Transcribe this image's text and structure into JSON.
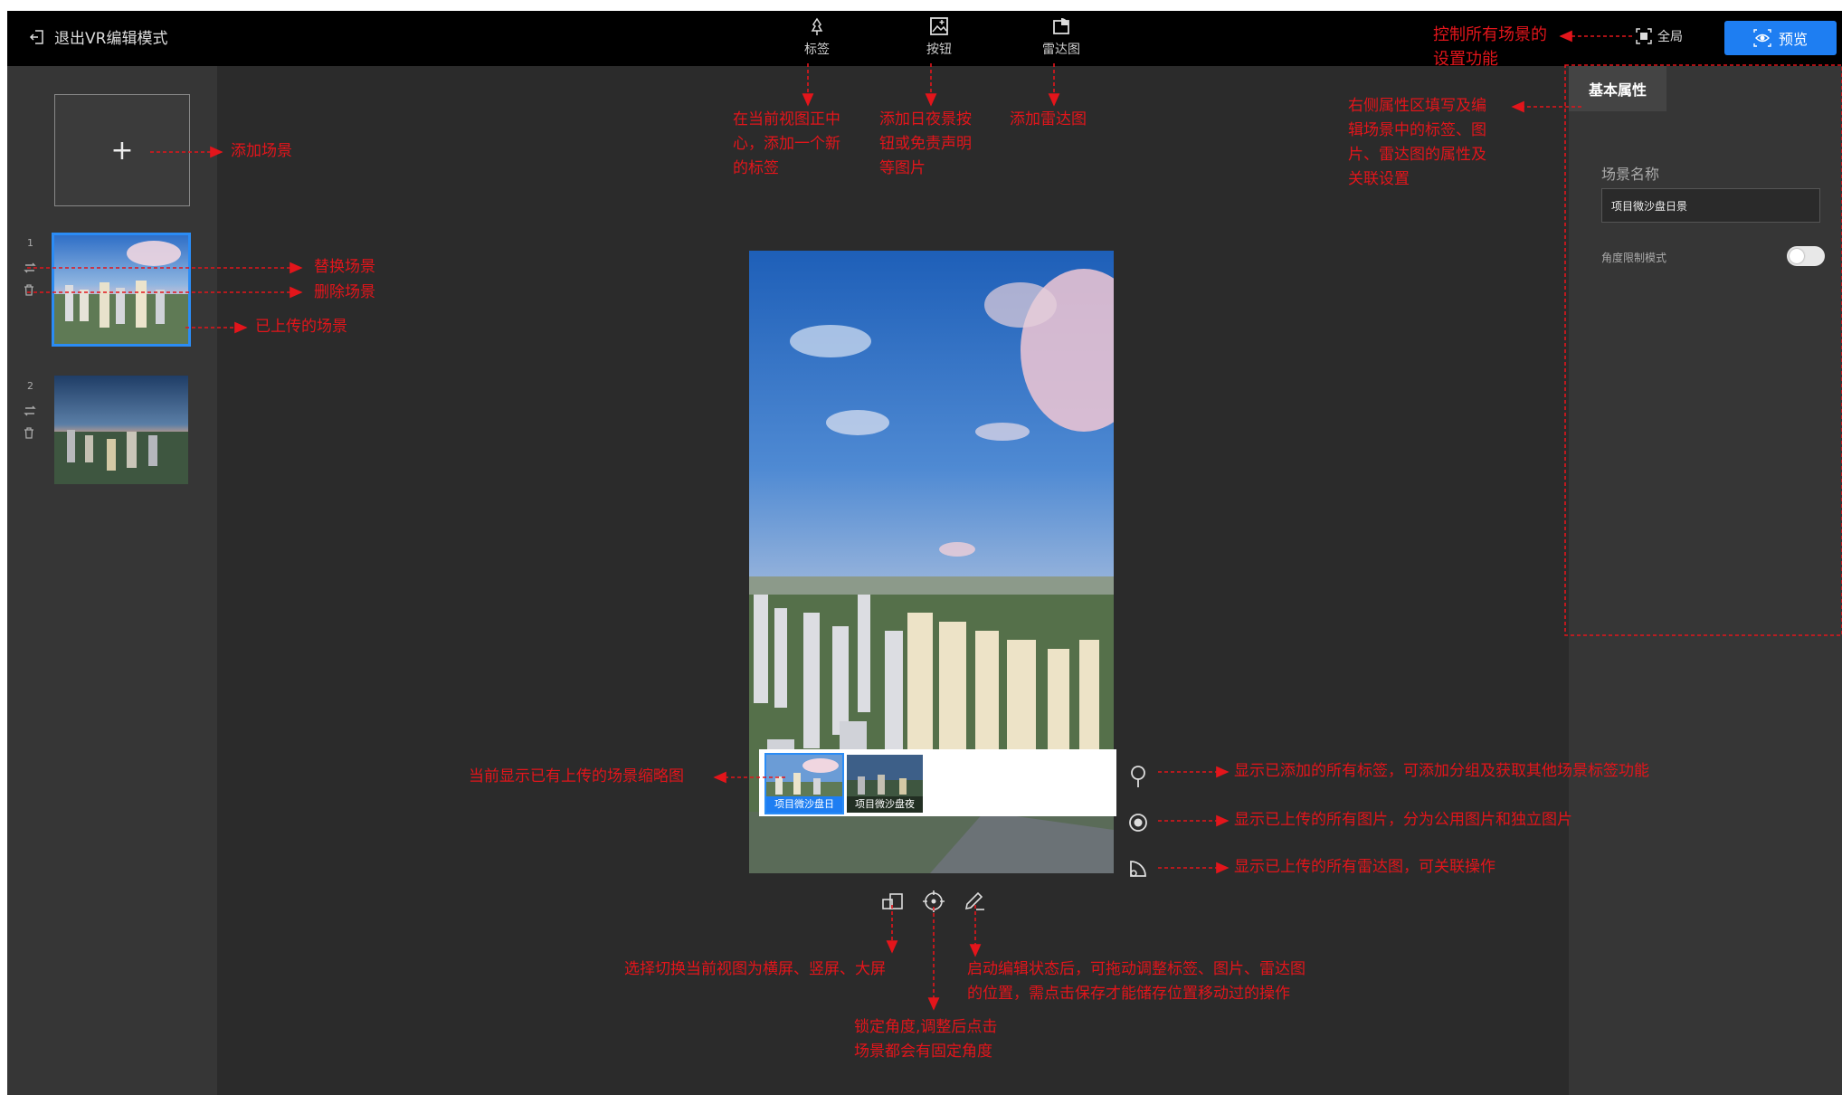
{
  "topbar": {
    "exit_label": "退出VR编辑模式",
    "tools": [
      {
        "label": "标签",
        "icon": "pin-icon"
      },
      {
        "label": "按钮",
        "icon": "image-add-icon"
      },
      {
        "label": "雷达图",
        "icon": "radar-icon"
      }
    ],
    "global_label": "全局",
    "preview_label": "预览"
  },
  "left_panel": {
    "add_symbol": "+",
    "scenes": [
      {
        "index": "1",
        "selected": true
      },
      {
        "index": "2",
        "selected": false
      }
    ]
  },
  "right_panel": {
    "tab_label": "基本属性",
    "scene_name_label": "场景名称",
    "scene_name_value": "项目微沙盘日景",
    "angle_limit_label": "角度限制模式",
    "angle_limit_on": false
  },
  "viewer": {
    "scene_thumbs": [
      {
        "caption": "项目微沙盘日"
      },
      {
        "caption": "项目微沙盘夜"
      }
    ],
    "bottom_tools": [
      "screen-switch-icon",
      "lock-angle-icon",
      "edit-icon"
    ],
    "right_tools": [
      "tag-list-icon",
      "image-list-icon",
      "radar-list-icon"
    ]
  },
  "annotations": {
    "add_scene": "添加场景",
    "replace_scene": "替换场景",
    "delete_scene": "删除场景",
    "uploaded_scene": "已上传的场景",
    "tag_tool": [
      "在当前视图正中",
      "心，添加一个新",
      "的标签"
    ],
    "button_tool": [
      "添加日夜景按",
      "钮或免责声明",
      "等图片"
    ],
    "radar_tool": "添加雷达图",
    "global_control": [
      "控制所有场景的",
      "设置功能"
    ],
    "right_panel": [
      "右侧属性区填写及编",
      "辑场景中的标签、图",
      "片、雷达图的属性及",
      "关联设置"
    ],
    "thumb_strip": "当前显示已有上传的场景缩略图",
    "tags_list": "显示已添加的所有标签，可添加分组及获取其他场景标签功能",
    "images_list": "显示已上传的所有图片，分为公用图片和独立图片",
    "radar_list": "显示已上传的所有雷达图，可关联操作",
    "switch_view": "选择切换当前视图为横屏、竖屏、大屏",
    "lock_angle": [
      "锁定角度,调整后点击",
      "场景都会有固定角度"
    ],
    "edit_mode": [
      "启动编辑状态后，可拖动调整标签、图片、雷达图",
      "的位置，需点击保存才能储存位置移动过的操作"
    ]
  }
}
